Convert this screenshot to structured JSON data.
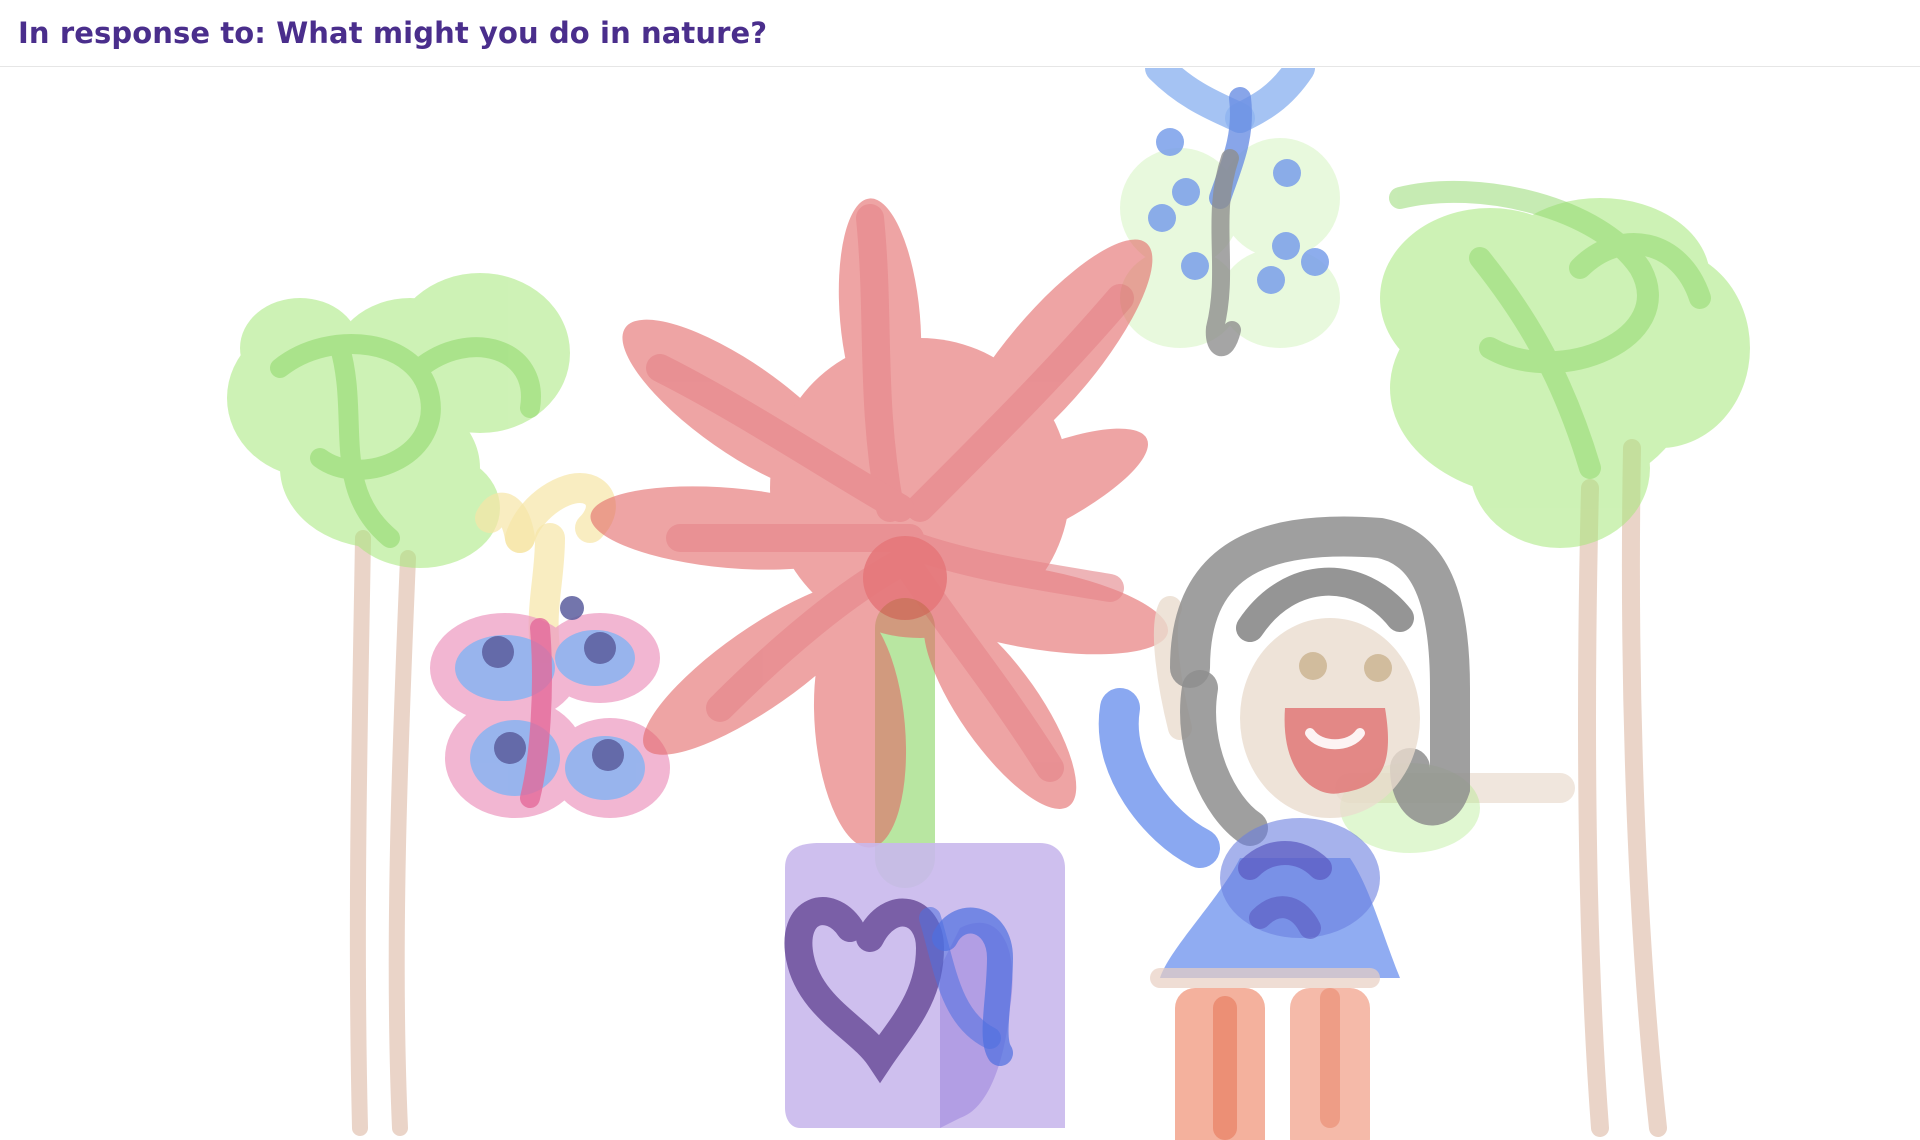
{
  "header": {
    "prompt_label": "In response to: What might you do in nature?"
  },
  "drawing": {
    "subject_icons": [
      "left-tree-icon",
      "right-tree-icon",
      "big-red-flower-icon",
      "flower-pot-icon",
      "heart-icon",
      "pink-butterfly-icon",
      "blue-butterfly-icon",
      "girl-figure-icon"
    ],
    "colors": {
      "tree_leaves": "#a6e87a",
      "tree_trunk": "#e8cfc2",
      "flower_petals": "#e36868",
      "flower_stem": "#a6e08a",
      "pot": "#c9b8ec",
      "heart": "#5d3f8f",
      "butterfly_wing_pink": "#ee9ec3",
      "butterfly_body_blue": "#8fb4f0",
      "dots": "#7a8fd9",
      "hair": "#8e8e8e",
      "dress": "#7d9ef0",
      "legs": "#f2a38c",
      "face": "#eadcce",
      "mouth": "#e07878"
    }
  }
}
